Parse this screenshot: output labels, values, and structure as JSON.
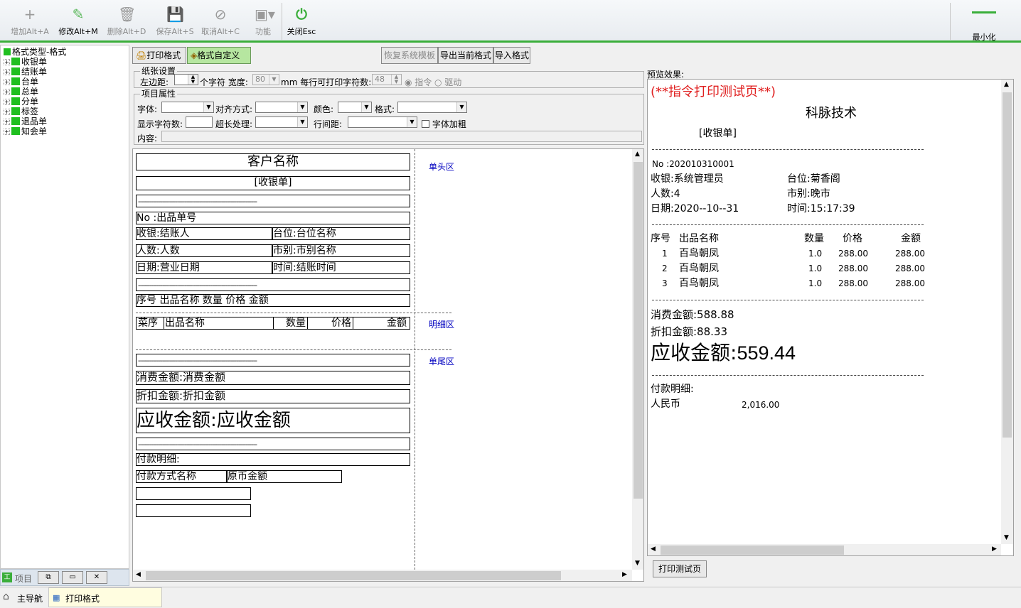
{
  "toolbar": {
    "add": "增加Alt+A",
    "edit": "修改Alt+M",
    "delete": "删除Alt+D",
    "save": "保存Alt+S",
    "cancel": "取消Alt+C",
    "func": "功能",
    "close": "关闭Esc",
    "minimize": "最小化"
  },
  "tree": {
    "root": "格式类型-格式",
    "items": [
      "收银单",
      "结账单",
      "台单",
      "总单",
      "分单",
      "标签",
      "退品单",
      "知会单"
    ]
  },
  "left_bottom": {
    "label": "项目"
  },
  "statusbar": {
    "nav": "主导航",
    "tab": "打印格式"
  },
  "tabs": {
    "print_format": "打印格式",
    "custom_format": "格式自定义"
  },
  "actions": {
    "restore": "恢复系统模板",
    "export": "导出当前格式",
    "import": "导入格式"
  },
  "paper": {
    "title": "纸张设置",
    "left_margin_label": "左边距:",
    "chars_label": "个字符 宽度:",
    "width_value": "80",
    "mm_label": "mm 每行可打印字符数:",
    "chars_value": "48",
    "radio_cmd": "指令",
    "radio_driver": "驱动"
  },
  "item_props": {
    "title": "项目属性",
    "font": "字体:",
    "align": "对齐方式:",
    "color": "颜色:",
    "format": "格式:",
    "display_chars": "显示字符数:",
    "overflow": "超长处理:",
    "line_spacing": "行间距:",
    "bold": "字体加粗",
    "content": "内容:"
  },
  "designer": {
    "customer_name": "客户名称",
    "receipt": "[收银单]",
    "dash": "----------------------------------------------------------------",
    "no": "No :出品单号",
    "cashier": "收银:结账人",
    "table": "台位:台位名称",
    "people": "人数:人数",
    "market": "市别:市别名称",
    "date": "日期:营业日期",
    "time": "时间:结账时间",
    "header_row": "序号 出品名称         数量   价格       金额",
    "detail_seq": "菜序",
    "detail_name": "出品名称",
    "detail_qty": "数量",
    "detail_price": "价格",
    "detail_amount": "金额",
    "consume": "消费金额:消费金额",
    "discount": "折扣金额:折扣金额",
    "receivable": "应收金额:应收金额",
    "payment": "付款明细:",
    "pay_method": "付款方式名称",
    "pay_amount": "原币金额",
    "zone_header": "单头区",
    "zone_detail": "明细区",
    "zone_footer": "单尾区"
  },
  "preview": {
    "label": "预览效果:",
    "test_title": "(**指令打印测试页**)",
    "company": "科脉技术",
    "receipt": "[收银单]",
    "no": "No :202010310001",
    "cashier": "收银:系统管理员",
    "table": "台位:菊香阁",
    "people": "人数:4",
    "market": "市别:晚市",
    "date": "日期:2020--10--31",
    "time": "时间:15:17:39",
    "col_seq": "序号",
    "col_name": "出品名称",
    "col_qty": "数量",
    "col_price": "价格",
    "col_amount": "金额",
    "rows": [
      {
        "seq": "1",
        "name": "百鸟朝凤",
        "qty": "1.0",
        "price": "288.00",
        "amount": "288.00"
      },
      {
        "seq": "2",
        "name": "百鸟朝凤",
        "qty": "1.0",
        "price": "288.00",
        "amount": "288.00"
      },
      {
        "seq": "3",
        "name": "百鸟朝凤",
        "qty": "1.0",
        "price": "288.00",
        "amount": "288.00"
      }
    ],
    "consume": "消费金额:588.88",
    "discount": "折扣金额:88.33",
    "receivable_label": "应收金额:",
    "receivable_value": "559.44",
    "payment": "付款明细:",
    "rmb": "人民币",
    "rmb_value": "2,016.00"
  },
  "print_test_button": "打印测试页",
  "colors": {
    "accent_green": "#3aae3a",
    "red_title": "#e02020",
    "zone_blue": "#0000c0"
  }
}
